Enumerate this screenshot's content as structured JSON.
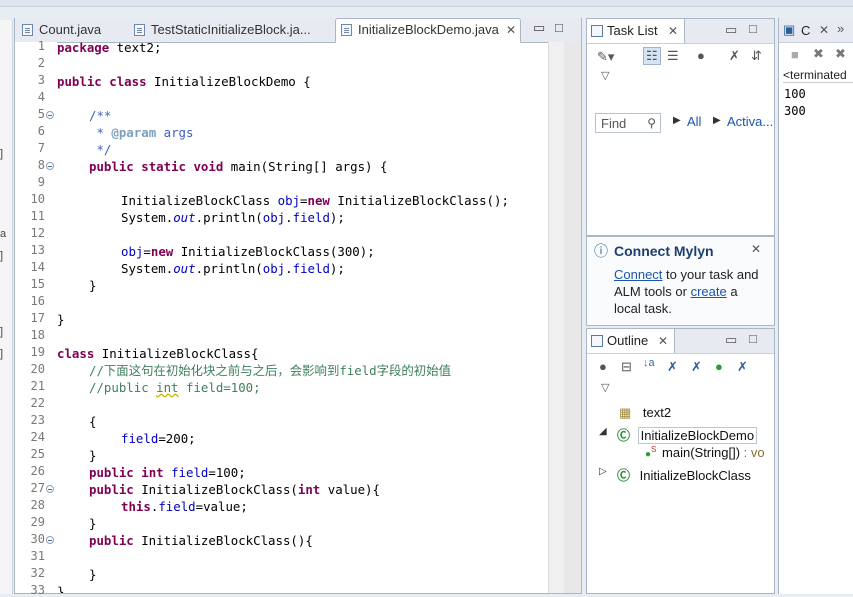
{
  "tabs": [
    {
      "label": "Count.java",
      "active": false
    },
    {
      "label": "TestStaticInitializeBlock.ja...",
      "active": false
    },
    {
      "label": "InitializeBlockDemo.java",
      "active": true
    }
  ],
  "editor_window_controls": {
    "minimize": "▭",
    "maximize": "□"
  },
  "left_strip_markers": [
    "]",
    "a",
    "]",
    "]",
    "]"
  ],
  "line_numbers": [
    "1",
    "2",
    "3",
    "4",
    "5",
    "6",
    "7",
    "8",
    "9",
    "10",
    "11",
    "12",
    "13",
    "14",
    "15",
    "16",
    "17",
    "18",
    "19",
    "20",
    "21",
    "22",
    "23",
    "24",
    "25",
    "26",
    "27",
    "28",
    "29",
    "30",
    "31",
    "32",
    "33"
  ],
  "code_text": {
    "l1_kw": "package",
    "l1_rest": " text2;",
    "l3_kw1": "public",
    "l3_kw2": "class",
    "l3_rest": " InitializeBlockDemo {",
    "l5": "/**",
    "l6_a": " * ",
    "l6_tag": "@param",
    "l6_b": " args",
    "l7": " */",
    "l8_kw1": "public",
    "l8_kw2": "static",
    "l8_kw3": "void",
    "l8_rest": " main(String[] args) {",
    "l10_a": "InitializeBlockClass ",
    "l10_fd": "obj",
    "l10_b": "=",
    "l10_kw": "new",
    "l10_c": " InitializeBlockClass();",
    "l11_a": "System.",
    "l11_out": "out",
    "l11_b": ".println(",
    "l11_fd": "obj",
    "l11_c": ".",
    "l11_fd2": "field",
    "l11_d": ");",
    "l13_fd": "obj",
    "l13_b": "=",
    "l13_kw": "new",
    "l13_c": " InitializeBlockClass(300);",
    "l14_a": "System.",
    "l14_out": "out",
    "l14_b": ".println(",
    "l14_fd": "obj",
    "l14_c": ".",
    "l14_fd2": "field",
    "l14_d": ");",
    "l15": "}",
    "l17": "}",
    "l19_kw": "class",
    "l19_rest": " InitializeBlockClass{",
    "l20": "//下面这句在初始化块之前与之后，会影响到field字段的初始值",
    "l21_a": "//public ",
    "l21_int": "int",
    "l21_b": " field=100;",
    "l23": "{",
    "l24_fd": "field",
    "l24_rest": "=200;",
    "l25": "}",
    "l26_kw1": "public",
    "l26_kw2": "int",
    "l26_fd": " field",
    "l26_rest": "=100;",
    "l27_kw1": "public",
    "l27_a": " InitializeBlockClass(",
    "l27_kw2": "int",
    "l27_b": " value){",
    "l28_kw": "this",
    "l28_a": ".",
    "l28_fd": "field",
    "l28_b": "=value;",
    "l29": "}",
    "l30_kw": "public",
    "l30_rest": " InitializeBlockClass(){",
    "l32": "}",
    "l33": "}"
  },
  "tasklist": {
    "title": "Task List",
    "find_placeholder": "Find",
    "filter_all": "All",
    "filter_activate": "Activa..."
  },
  "mylyn": {
    "title": "Connect Mylyn",
    "connect_link": "Connect",
    "text1": " to your task and",
    "text2": "ALM tools or ",
    "create_link": "create",
    "text3": " a",
    "text4": "local task."
  },
  "outline": {
    "title": "Outline",
    "items": [
      {
        "label": "text2"
      },
      {
        "label": "InitializeBlockDemo"
      },
      {
        "label": "main(String[])",
        "suffix": " : vo"
      },
      {
        "label": "InitializeBlockClass"
      }
    ]
  },
  "console": {
    "tab_label": "C",
    "status": "<terminated",
    "output": [
      "100",
      "300"
    ]
  }
}
